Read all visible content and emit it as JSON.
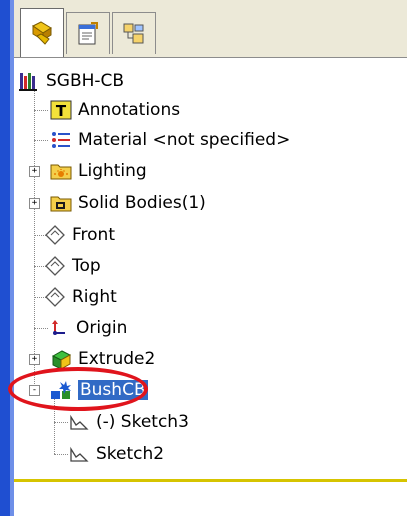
{
  "tabs": [
    {
      "name": "feature-manager",
      "icon": "feature-manager-icon",
      "active": true
    },
    {
      "name": "property-manager",
      "icon": "property-manager-icon",
      "active": false
    },
    {
      "name": "configuration-manager",
      "icon": "configuration-manager-icon",
      "active": false
    }
  ],
  "tree": {
    "root": {
      "label": "SGBH-CB",
      "icon": "part-icon"
    },
    "items": [
      {
        "label": "Annotations",
        "icon": "annotations-icon"
      },
      {
        "label": "Material <not specified>",
        "icon": "material-icon"
      },
      {
        "label": "Lighting",
        "icon": "lighting-folder-icon",
        "expander": "+"
      },
      {
        "label": "Solid Bodies(1)",
        "icon": "solid-bodies-folder-icon",
        "expander": "+"
      },
      {
        "label": "Front",
        "icon": "plane-icon"
      },
      {
        "label": "Top",
        "icon": "plane-icon"
      },
      {
        "label": "Right",
        "icon": "plane-icon"
      },
      {
        "label": "Origin",
        "icon": "origin-icon"
      },
      {
        "label": "Extrude2",
        "icon": "extrude-icon",
        "expander": "+"
      },
      {
        "label": "BushCB",
        "icon": "hole-wizard-icon",
        "expander": "-",
        "selected": true
      },
      {
        "label": "(-) Sketch3",
        "icon": "sketch-icon"
      },
      {
        "label": "Sketch2",
        "icon": "sketch-icon"
      }
    ]
  },
  "colors": {
    "selection": "#316ac5",
    "highlight_ring": "#e0141c",
    "divider": "#d6c400",
    "frame": "#1f4fd1"
  }
}
